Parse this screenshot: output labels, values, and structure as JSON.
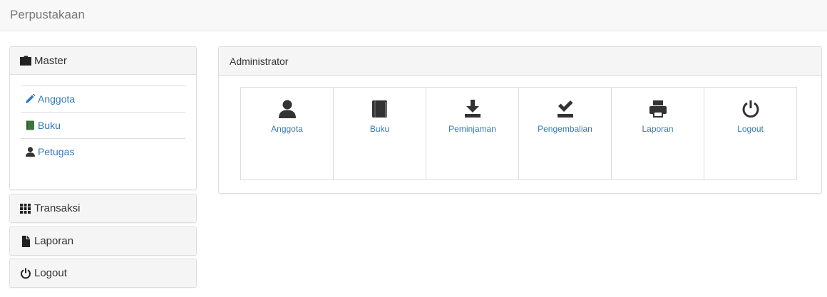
{
  "navbar": {
    "brand": "Perpustakaan"
  },
  "sidebar": {
    "master": {
      "label": "Master",
      "icon": "folder-icon",
      "items": [
        {
          "label": "Anggota",
          "icon": "pencil-icon"
        },
        {
          "label": "Buku",
          "icon": "book-icon"
        },
        {
          "label": "Petugas",
          "icon": "user-icon"
        }
      ]
    },
    "transaksi": {
      "label": "Transaksi",
      "icon": "grid-icon"
    },
    "laporan": {
      "label": "Laporan",
      "icon": "file-icon"
    },
    "logout": {
      "label": "Logout",
      "icon": "power-icon"
    }
  },
  "main": {
    "title": "Administrator",
    "tiles": [
      {
        "label": "Anggota",
        "icon": "user-icon"
      },
      {
        "label": "Buku",
        "icon": "book-icon"
      },
      {
        "label": "Peminjaman",
        "icon": "download-icon"
      },
      {
        "label": "Pengembalian",
        "icon": "check-tray-icon"
      },
      {
        "label": "Laporan",
        "icon": "print-icon"
      },
      {
        "label": "Logout",
        "icon": "power-icon"
      }
    ]
  },
  "colors": {
    "link": "#337ab7",
    "icon_dark": "#333333",
    "book_green": "#3c763d",
    "panel_heading": "#f5f5f5",
    "border": "#dddddd"
  }
}
